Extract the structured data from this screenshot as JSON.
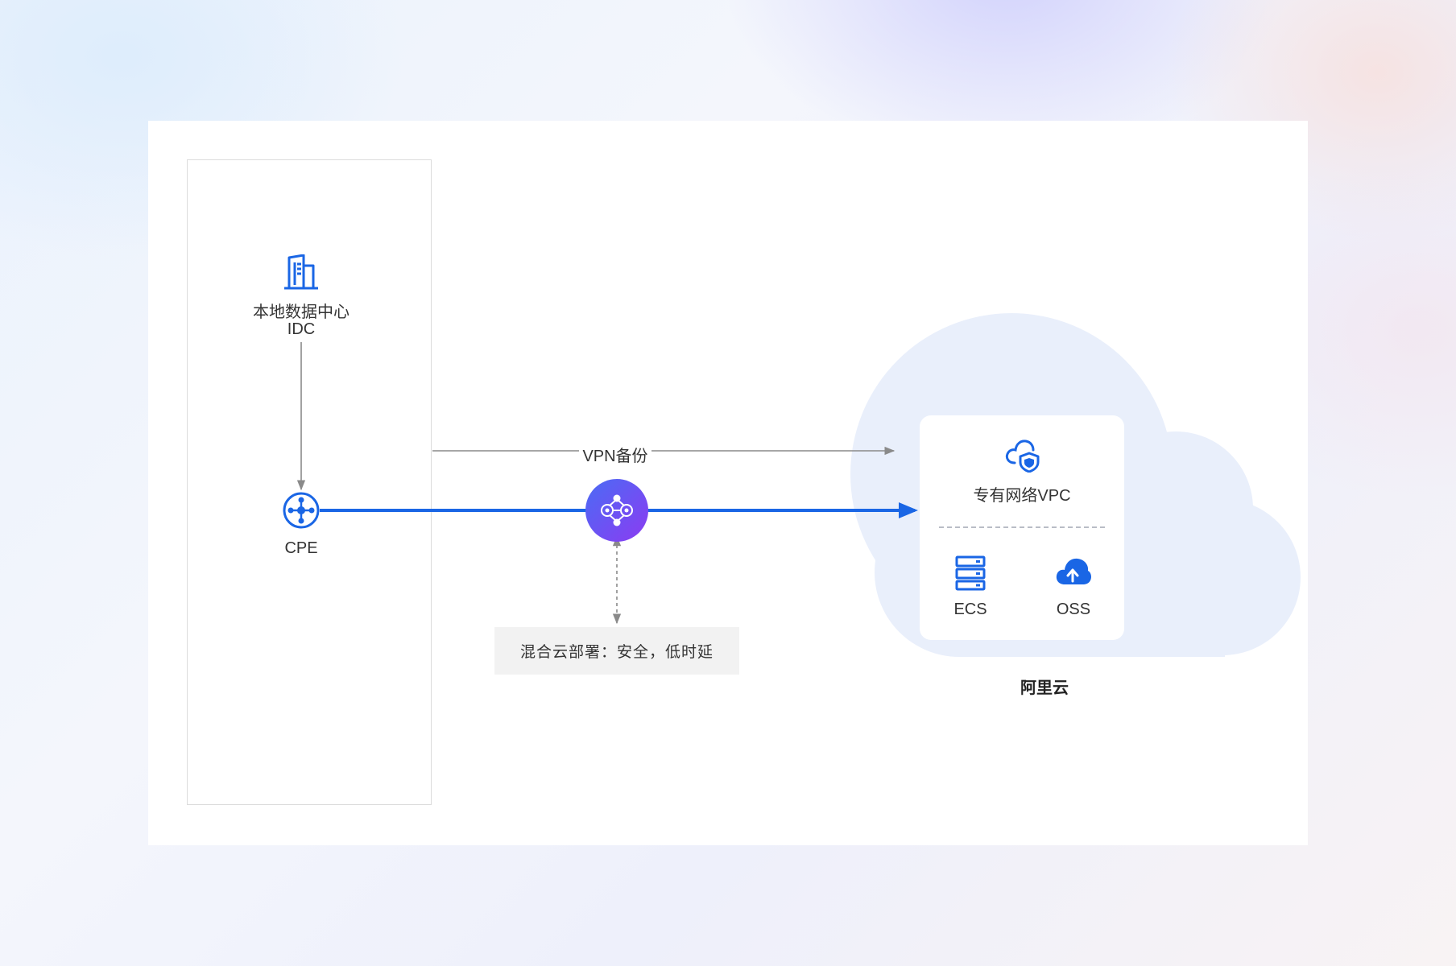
{
  "idc": {
    "title": "本地数据中心",
    "subtitle": "IDC",
    "cpe_label": "CPE"
  },
  "link": {
    "vpn_label": "VPN备份",
    "note": "混合云部署：安全，低时延"
  },
  "cloud": {
    "vpc_label": "专有网络VPC",
    "ecs_label": "ECS",
    "oss_label": "OSS",
    "provider": "阿里云"
  },
  "colors": {
    "primary": "#1a66e5",
    "cloud_fill": "#e9effb",
    "hub_start": "#4a6cf4",
    "hub_end": "#8c3bf2",
    "arrow_gray": "#8a8a8a"
  },
  "icons": {
    "idc": "building-icon",
    "cpe": "network-node-icon",
    "hub": "connection-hub-icon",
    "vpc": "cloud-shield-icon",
    "ecs": "server-stack-icon",
    "oss": "cloud-upload-icon"
  }
}
